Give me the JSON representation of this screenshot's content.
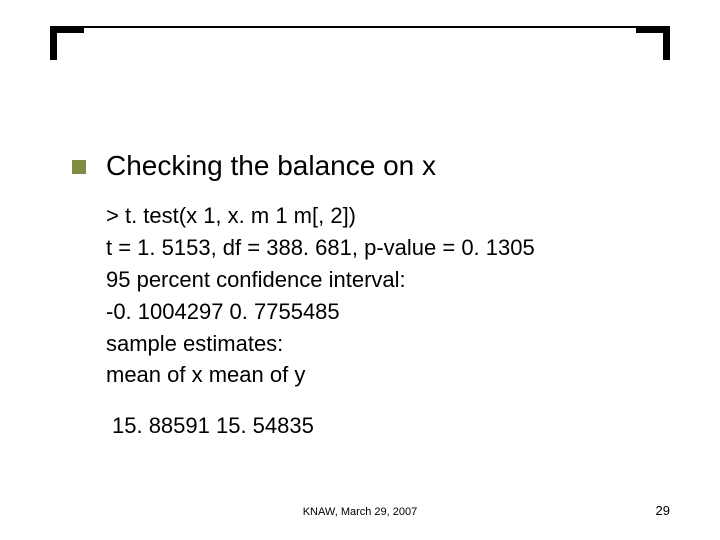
{
  "heading": "Checking the balance on x",
  "body": {
    "l1": "> t. test(x 1, x. m 1 m[, 2])",
    "l2": "t = 1. 5153, df = 388. 681, p-value = 0. 1305",
    "l3": "95 percent confidence interval:",
    "l4": " -0. 1004297  0. 7755485",
    "l5": "sample estimates:",
    "l6": "mean of x mean of y"
  },
  "means": "15. 88591  15. 54835",
  "footer": {
    "center": "KNAW, March 29, 2007",
    "page": "29"
  }
}
